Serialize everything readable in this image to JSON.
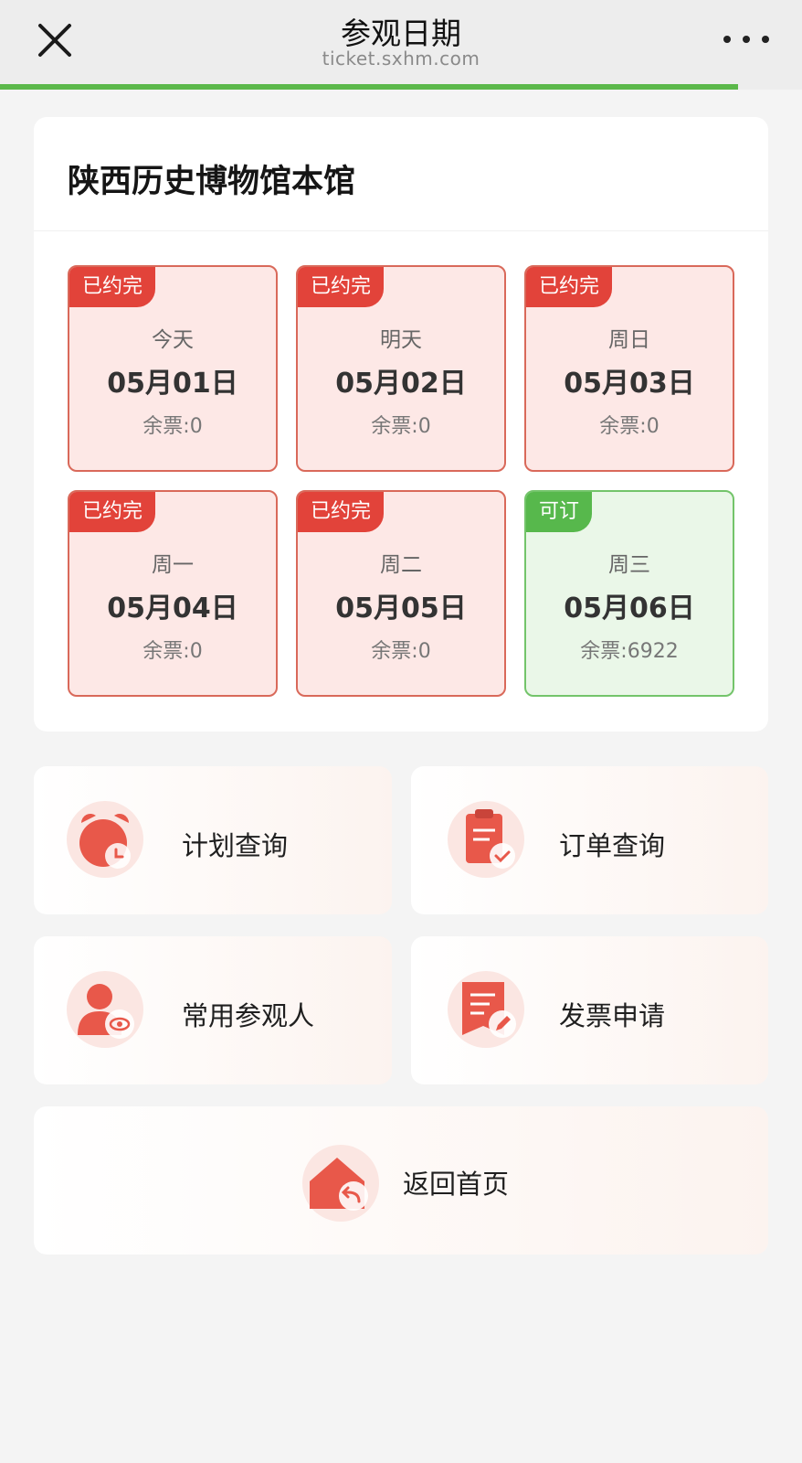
{
  "nav": {
    "title": "参观日期",
    "url": "ticket.sxhm.com",
    "close_icon": "close-icon",
    "more_icon": "more-icon",
    "load_progress_percent": 92
  },
  "venue": {
    "name": "陕西历史博物馆本馆",
    "dates": [
      {
        "status": "已约完",
        "weekday": "今天",
        "date": "05月01日",
        "remaining": "余票:0",
        "available": false
      },
      {
        "status": "已约完",
        "weekday": "明天",
        "date": "05月02日",
        "remaining": "余票:0",
        "available": false
      },
      {
        "status": "已约完",
        "weekday": "周日",
        "date": "05月03日",
        "remaining": "余票:0",
        "available": false
      },
      {
        "status": "已约完",
        "weekday": "周一",
        "date": "05月04日",
        "remaining": "余票:0",
        "available": false
      },
      {
        "status": "已约完",
        "weekday": "周二",
        "date": "05月05日",
        "remaining": "余票:0",
        "available": false
      },
      {
        "status": "可订",
        "weekday": "周三",
        "date": "05月06日",
        "remaining": "余票:6922",
        "available": true
      }
    ]
  },
  "menu": {
    "plan_query": {
      "label": "计划查询",
      "icon": "alarm-clock-icon"
    },
    "order_query": {
      "label": "订单查询",
      "icon": "clipboard-check-icon"
    },
    "visitors": {
      "label": "常用参观人",
      "icon": "person-eye-icon"
    },
    "invoice": {
      "label": "发票申请",
      "icon": "invoice-edit-icon"
    },
    "home": {
      "label": "返回首页",
      "icon": "home-return-icon"
    }
  },
  "colors": {
    "sold_out_border": "#d9695a",
    "sold_out_badge": "#e2433a",
    "available_border": "#73c46a",
    "available_badge": "#57b84c",
    "progress": "#5bb84a",
    "icon_red": "#e8584a"
  }
}
